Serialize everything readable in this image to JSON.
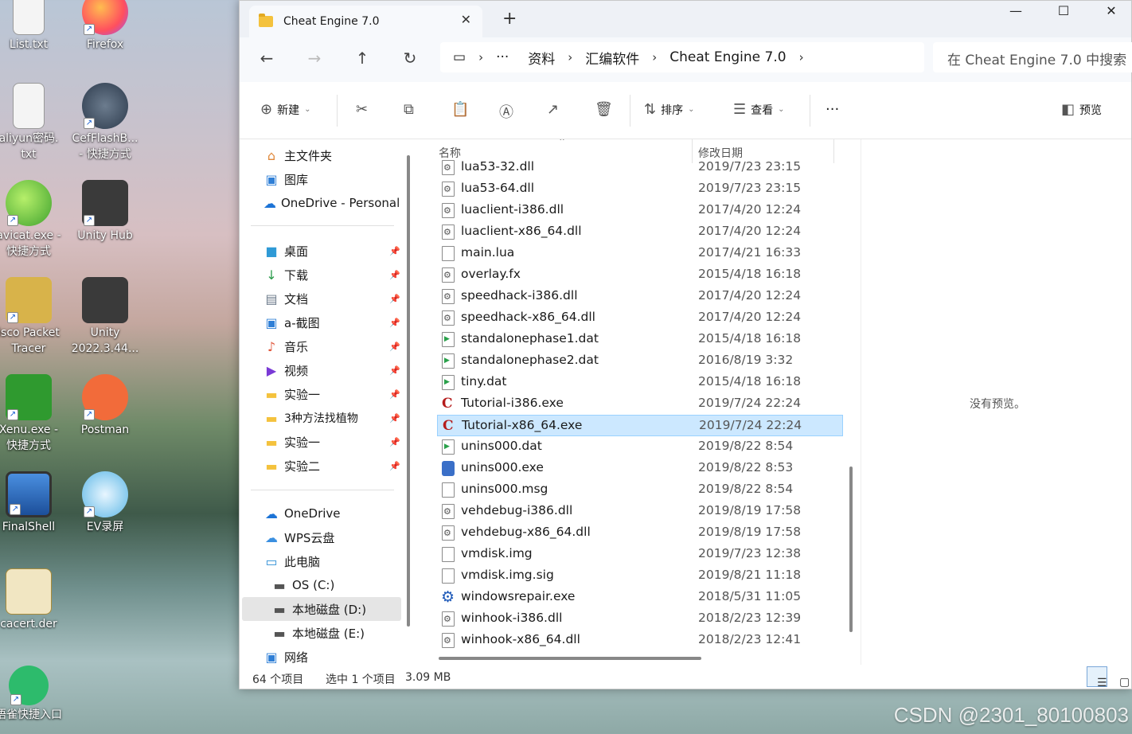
{
  "desktop": {
    "icons": [
      {
        "label": "List.txt"
      },
      {
        "label": "Firefox"
      },
      {
        "label": "aliyun密码.\ntxt"
      },
      {
        "label": "CefFlashB...\n- 快捷方式"
      },
      {
        "label": "avicat.exe -\n快捷方式"
      },
      {
        "label": "Unity Hub"
      },
      {
        "label": "isco Packet\nTracer"
      },
      {
        "label": "Unity\n2022.3.44..."
      },
      {
        "label": "Xenu.exe -\n快捷方式"
      },
      {
        "label": "Postman"
      },
      {
        "label": "FinalShell"
      },
      {
        "label": "EV录屏"
      },
      {
        "label": "cacert.der"
      },
      {
        "label": "语雀快捷入口"
      }
    ],
    "watermark": "CSDN @2301_80100803"
  },
  "window": {
    "tab_title": "Cheat Engine 7.0",
    "tab_close": "✕",
    "new_tab": "+",
    "controls": {
      "minimize": "—",
      "maximize": "☐",
      "close": "✕"
    },
    "nav": {
      "back": "←",
      "forward": "→",
      "up": "↑",
      "refresh": "↻"
    },
    "breadcrumb": {
      "pc_icon": "▭",
      "more": "···",
      "items": [
        "资料",
        "汇编软件",
        "Cheat Engine 7.0"
      ]
    },
    "search_placeholder": "在 Cheat Engine 7.0 中搜索",
    "toolbar": {
      "new_label": "新建",
      "sort_label": "排序",
      "view_label": "查看",
      "more": "···",
      "preview_label": "预览"
    }
  },
  "navpane": {
    "items": [
      {
        "label": "主文件夹",
        "icon": "home-icon"
      },
      {
        "label": "图库",
        "icon": "gallery-icon"
      },
      {
        "label": "OneDrive - Personal",
        "icon": "cloud-icon"
      },
      {
        "label": "桌面",
        "icon": "desktop-icon"
      },
      {
        "label": "下载",
        "icon": "download-icon"
      },
      {
        "label": "文档",
        "icon": "document-icon"
      },
      {
        "label": "a-截图",
        "icon": "picture-icon"
      },
      {
        "label": "音乐",
        "icon": "music-icon"
      },
      {
        "label": "视频",
        "icon": "video-icon"
      },
      {
        "label": "实验一",
        "icon": "folder-icon"
      },
      {
        "label": "3种方法找植物",
        "icon": "folder-icon"
      },
      {
        "label": "实验一",
        "icon": "folder-icon"
      },
      {
        "label": "实验二",
        "icon": "folder-icon"
      },
      {
        "label": "OneDrive",
        "icon": "cloud-icon"
      },
      {
        "label": "WPS云盘",
        "icon": "cloud-icon"
      },
      {
        "label": "此电脑",
        "icon": "pc-icon"
      },
      {
        "label": "OS (C:)",
        "icon": "drive-icon"
      },
      {
        "label": "本地磁盘 (D:)",
        "icon": "drive-icon"
      },
      {
        "label": "本地磁盘 (E:)",
        "icon": "drive-icon"
      },
      {
        "label": "网络",
        "icon": "network-icon"
      }
    ]
  },
  "filelist": {
    "columns": {
      "name": "名称",
      "date": "修改日期"
    },
    "rows": [
      {
        "name": "lua53-32.dll",
        "date": "2019/7/23 23:15",
        "icon": "gear"
      },
      {
        "name": "lua53-64.dll",
        "date": "2019/7/23 23:15",
        "icon": "gear"
      },
      {
        "name": "luaclient-i386.dll",
        "date": "2017/4/20 12:24",
        "icon": "gear"
      },
      {
        "name": "luaclient-x86_64.dll",
        "date": "2017/4/20 12:24",
        "icon": "gear"
      },
      {
        "name": "main.lua",
        "date": "2017/4/21 16:33",
        "icon": "plain"
      },
      {
        "name": "overlay.fx",
        "date": "2015/4/18 16:18",
        "icon": "gear"
      },
      {
        "name": "speedhack-i386.dll",
        "date": "2017/4/20 12:24",
        "icon": "gear"
      },
      {
        "name": "speedhack-x86_64.dll",
        "date": "2017/4/20 12:24",
        "icon": "gear"
      },
      {
        "name": "standalonephase1.dat",
        "date": "2015/4/18 16:18",
        "icon": "play"
      },
      {
        "name": "standalonephase2.dat",
        "date": "2016/8/19 3:32",
        "icon": "play"
      },
      {
        "name": "tiny.dat",
        "date": "2015/4/18 16:18",
        "icon": "play"
      },
      {
        "name": "Tutorial-i386.exe",
        "date": "2019/7/24 22:24",
        "icon": "ce"
      },
      {
        "name": "Tutorial-x86_64.exe",
        "date": "2019/7/24 22:24",
        "icon": "ce",
        "selected": true
      },
      {
        "name": "unins000.dat",
        "date": "2019/8/22 8:54",
        "icon": "play"
      },
      {
        "name": "unins000.exe",
        "date": "2019/8/22 8:53",
        "icon": "inst"
      },
      {
        "name": "unins000.msg",
        "date": "2019/8/22 8:54",
        "icon": "plain"
      },
      {
        "name": "vehdebug-i386.dll",
        "date": "2019/8/19 17:58",
        "icon": "gear"
      },
      {
        "name": "vehdebug-x86_64.dll",
        "date": "2019/8/19 17:58",
        "icon": "gear"
      },
      {
        "name": "vmdisk.img",
        "date": "2019/7/23 12:38",
        "icon": "plain"
      },
      {
        "name": "vmdisk.img.sig",
        "date": "2019/8/21 11:18",
        "icon": "plain"
      },
      {
        "name": "windowsrepair.exe",
        "date": "2018/5/31 11:05",
        "icon": "wr"
      },
      {
        "name": "winhook-i386.dll",
        "date": "2018/2/23 12:39",
        "icon": "gear"
      },
      {
        "name": "winhook-x86_64.dll",
        "date": "2018/2/23 12:41",
        "icon": "gear"
      }
    ]
  },
  "preview": {
    "message": "没有预览。"
  },
  "statusbar": {
    "count": "64 个项目",
    "selection": "选中 1 个项目",
    "size": "3.09 MB"
  },
  "colors": {
    "selection": "#cce8ff",
    "folder": "#f4c23d",
    "accent": "#1a5fd0"
  }
}
